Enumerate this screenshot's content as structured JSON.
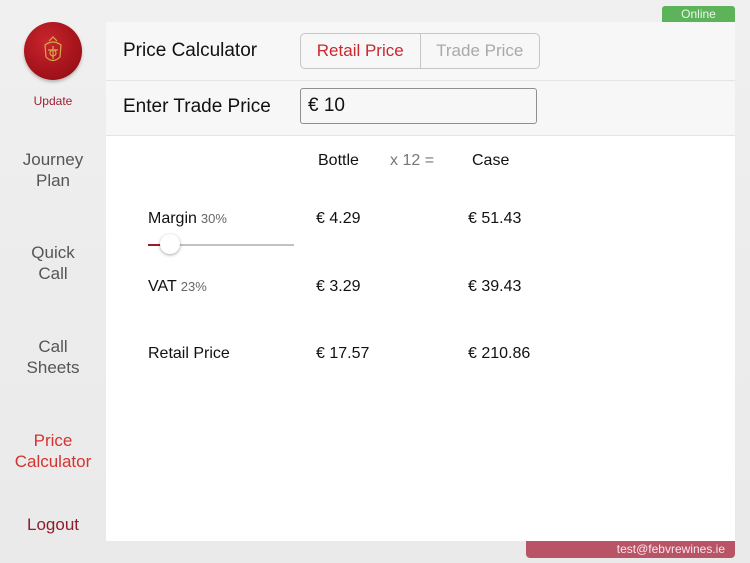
{
  "sidebar": {
    "update_label": "Update",
    "items": [
      {
        "label_line1": "Journey",
        "label_line2": "Plan",
        "active": false
      },
      {
        "label_line1": "Quick",
        "label_line2": "Call",
        "active": false
      },
      {
        "label_line1": "Call",
        "label_line2": "Sheets",
        "active": false
      },
      {
        "label_line1": "Price",
        "label_line2": "Calculator",
        "active": true
      }
    ],
    "logout_label": "Logout"
  },
  "status": {
    "connection": "Online",
    "user_email": "test@febvrewines.ie"
  },
  "colors": {
    "accent_red": "#d6322f",
    "online_green": "#5cb35a",
    "email_bar": "#b95466"
  },
  "header": {
    "title": "Price Calculator",
    "segments": [
      {
        "label": "Retail Price",
        "selected": true
      },
      {
        "label": "Trade Price",
        "selected": false
      }
    ]
  },
  "input_row": {
    "label": "Enter Trade Price",
    "value": "€ 10"
  },
  "table": {
    "col_bottle": "Bottle",
    "multiplier": "x  12  =",
    "col_case": "Case",
    "rows": [
      {
        "label": "Margin",
        "pct": "30%",
        "bottle": "€ 4.29",
        "case": "€ 51.43"
      },
      {
        "label": "VAT",
        "pct": "23%",
        "bottle": "€ 3.29",
        "case": "€ 39.43"
      },
      {
        "label": "Retail Price",
        "pct": "",
        "bottle": "€ 17.57",
        "case": "€ 210.86"
      }
    ],
    "margin_slider_fraction": 0.15
  }
}
